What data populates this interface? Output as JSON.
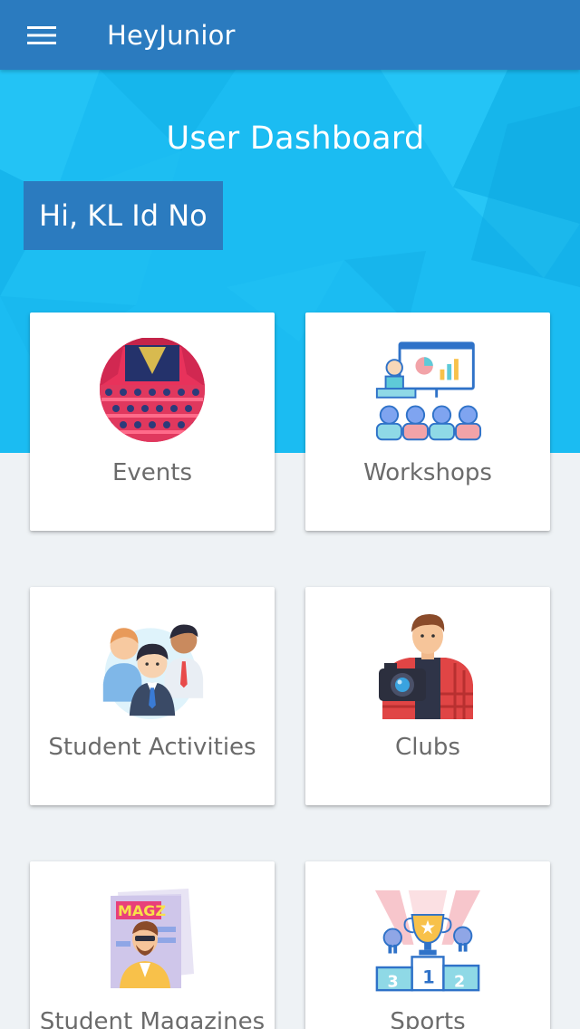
{
  "appbar": {
    "title": "HeyJunior",
    "menu_icon": "hamburger-menu-icon",
    "color": "#2b7bbf"
  },
  "hero": {
    "title": "User Dashboard",
    "greeting": "Hi, KL Id No",
    "color": "#1bbcf2"
  },
  "cards": [
    {
      "label": "Events",
      "icon": "theater-stage-icon"
    },
    {
      "label": "Workshops",
      "icon": "presentation-board-icon"
    },
    {
      "label": "Student Activities",
      "icon": "students-group-icon"
    },
    {
      "label": "Clubs",
      "icon": "photographer-icon"
    },
    {
      "label": "Student Magazines",
      "icon": "magazine-icon"
    },
    {
      "label": "Sports",
      "icon": "trophy-podium-icon"
    }
  ]
}
